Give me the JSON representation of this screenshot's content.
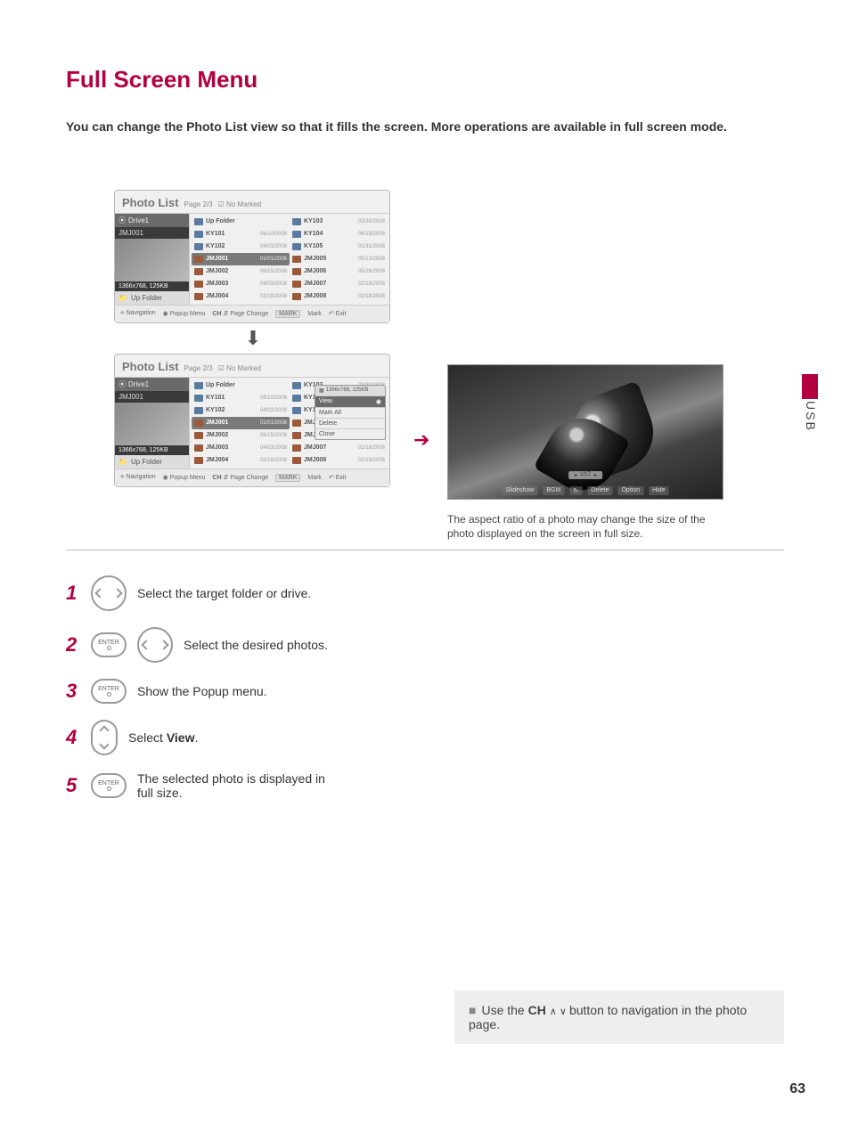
{
  "sideTab": "USB",
  "title": "Full Screen Menu",
  "intro": "You can change the Photo List view so that it fills the screen. More operations are available in full screen mode.",
  "pageNumber": "63",
  "photolist": {
    "title": "Photo List",
    "page": "Page 2/3",
    "noMarked": "No Marked",
    "drive": "Drive1",
    "folderName": "JMJ001",
    "meta": "1366x768, 125KB",
    "upFolder": "Up Folder",
    "rowsLeft": [
      {
        "name": "Up Folder",
        "date": "",
        "folder": true
      },
      {
        "name": "KY101",
        "date": "06/10/2008",
        "folder": true
      },
      {
        "name": "KY102",
        "date": "04/03/2008",
        "folder": true
      },
      {
        "name": "JMJ001",
        "date": "01/01/2008",
        "sel": true
      },
      {
        "name": "JMJ002",
        "date": "06/15/2008"
      },
      {
        "name": "JMJ003",
        "date": "04/03/2008"
      },
      {
        "name": "JMJ004",
        "date": "02/18/2008"
      }
    ],
    "rowsRight": [
      {
        "name": "KY103",
        "date": "03/30/2008",
        "folder": true
      },
      {
        "name": "KY104",
        "date": "06/19/2008",
        "folder": true
      },
      {
        "name": "KY105",
        "date": "01/31/2008",
        "folder": true
      },
      {
        "name": "JMJ005",
        "date": "05/13/2008"
      },
      {
        "name": "JMJ006",
        "date": "05/26/2008"
      },
      {
        "name": "JMJ007",
        "date": "02/18/2008"
      },
      {
        "name": "JMJ008",
        "date": "02/18/2008"
      }
    ],
    "footer": {
      "nav": "Navigation",
      "popup": "Popup Menu",
      "ch": "CH",
      "pageChange": "Page Change",
      "markBadge": "MARK",
      "mark": "Mark",
      "exit": "Exit"
    }
  },
  "popup": {
    "meta": "1366x768, 125KB",
    "view": "View",
    "markAll": "Mark All",
    "delete": "Delete",
    "close": "Close"
  },
  "fullscreen": {
    "counter": "1/17",
    "controls": [
      "Slideshow",
      "BGM",
      "Delete",
      "Option",
      "Hide"
    ],
    "caption": "The aspect ratio of a photo may change the size of the photo displayed on the screen in full size."
  },
  "steps": {
    "s1": "Select the target folder or drive.",
    "s2": "Select the desired photos.",
    "s3": "Show the Popup menu.",
    "s4_a": "Select ",
    "s4_b": "View",
    "s4_c": ".",
    "s5": "The selected photo is displayed in full size.",
    "enter": "ENTER"
  },
  "tip": {
    "a": "Use the ",
    "ch": "CH",
    "b": " button to navigation in the photo page."
  }
}
